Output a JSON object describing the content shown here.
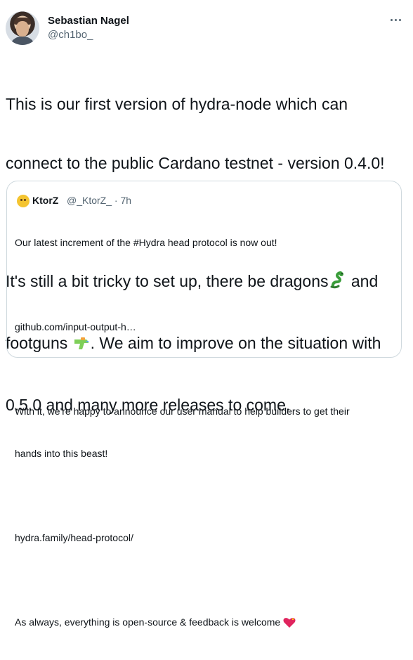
{
  "author": {
    "name": "Sebastian Nagel",
    "handle": "@ch1bo_"
  },
  "tweet": {
    "line1": "This is our first version of hydra-node which can",
    "line2": "connect to the public Cardano testnet - version 0.4.0!",
    "line3a": "It's still a bit tricky to set up, there be dragons",
    "line3b": " and",
    "line4a": "footguns ",
    "line4b": ". We aim to improve on the situation with",
    "line5": "0.5.0 and many more releases to come."
  },
  "quoted": {
    "name": "KtorZ",
    "handle_time": "@_KtorZ_ · 7h",
    "lines": [
      "Our latest increment of the #Hydra head protocol is now out!",
      "",
      "github.com/input-output-h…",
      "",
      "With it, we're happy to announce our user manual to help builders to get their",
      "hands into this beast!",
      "",
      "hydra.family/head-protocol/",
      "",
      "As always, everything is open-source & feedback is welcome"
    ]
  },
  "icons": {
    "more": "more-horizontal-icon",
    "dragon": "dragon-emoji",
    "water_gun": "water-gun-emoji",
    "heart": "sparkling-heart-emoji"
  },
  "colors": {
    "text": "#0f1419",
    "muted": "#536471",
    "border": "#cfd9de"
  }
}
